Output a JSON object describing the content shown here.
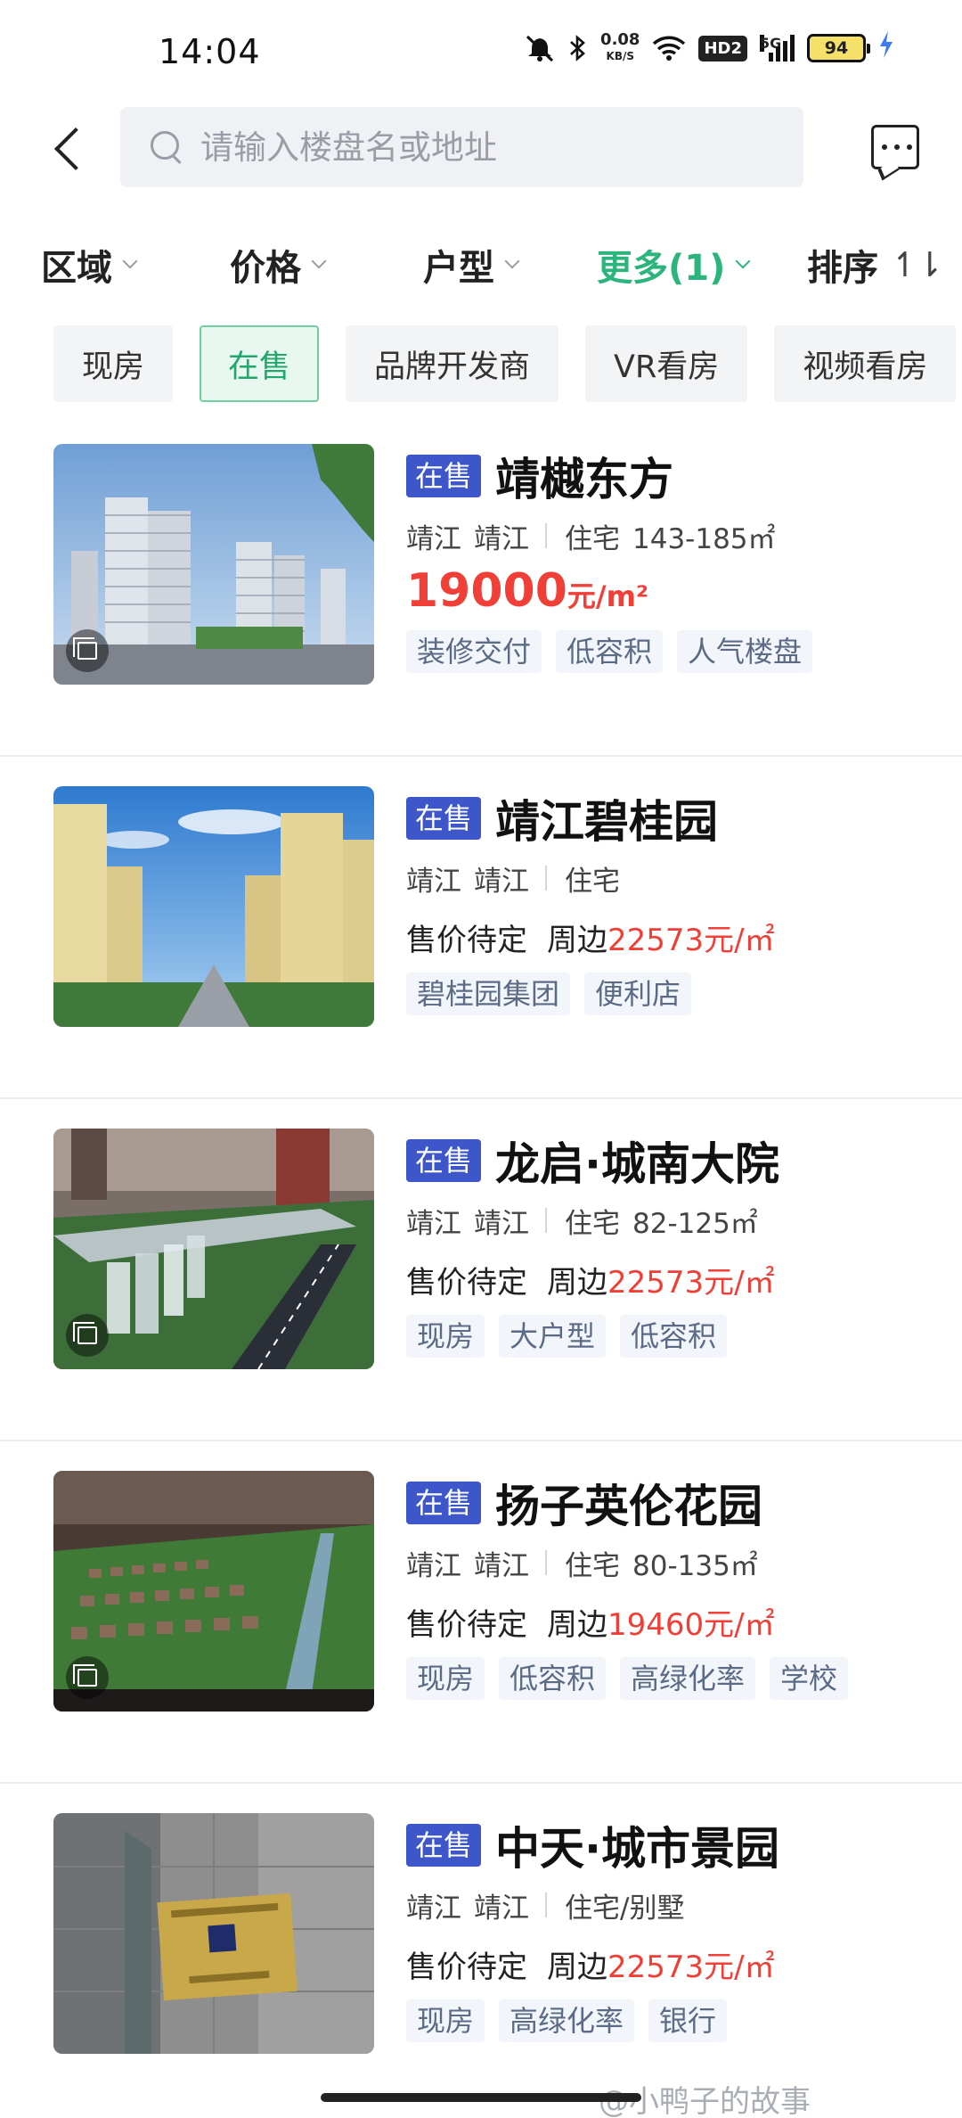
{
  "status_bar": {
    "time": "14:04",
    "net_speed_value": "0.08",
    "net_speed_unit": "KB/S",
    "hd_label": "HD2",
    "signal_label": "5G",
    "battery": "94",
    "icons": [
      "mute-icon",
      "bluetooth-icon",
      "wifi-icon",
      "charging-icon"
    ]
  },
  "header": {
    "search_placeholder": "请输入楼盘名或地址"
  },
  "filters": [
    {
      "label": "区域",
      "active": false
    },
    {
      "label": "价格",
      "active": false
    },
    {
      "label": "户型",
      "active": false
    },
    {
      "label": "更多(1)",
      "active": true
    },
    {
      "label": "排序",
      "active": false
    }
  ],
  "chips": [
    {
      "label": "现房",
      "selected": false
    },
    {
      "label": "在售",
      "selected": true
    },
    {
      "label": "品牌开发商",
      "selected": false
    },
    {
      "label": "VR看房",
      "selected": false
    },
    {
      "label": "视频看房",
      "selected": false
    }
  ],
  "listings": [
    {
      "status": "在售",
      "name": "靖樾东方",
      "district": "靖江",
      "area": "靖江",
      "type": "住宅",
      "size": "143-185㎡",
      "price_value": "19000",
      "price_unit": "元/m²",
      "tags": [
        "装修交付",
        "低容积",
        "人气楼盘"
      ],
      "has_vr": true
    },
    {
      "status": "在售",
      "name": "靖江碧桂园",
      "district": "靖江",
      "area": "靖江",
      "type": "住宅",
      "size": "",
      "price_pending": "售价待定",
      "nearby_label": "周边",
      "nearby_price": "22573元/㎡",
      "tags": [
        "碧桂园集团",
        "便利店"
      ],
      "has_vr": false
    },
    {
      "status": "在售",
      "name": "龙启·城南大院",
      "district": "靖江",
      "area": "靖江",
      "type": "住宅",
      "size": "82-125㎡",
      "price_pending": "售价待定",
      "nearby_label": "周边",
      "nearby_price": "22573元/㎡",
      "tags": [
        "现房",
        "大户型",
        "低容积"
      ],
      "has_vr": true
    },
    {
      "status": "在售",
      "name": "扬子英伦花园",
      "district": "靖江",
      "area": "靖江",
      "type": "住宅",
      "size": "80-135㎡",
      "price_pending": "售价待定",
      "nearby_label": "周边",
      "nearby_price": "19460元/㎡",
      "tags": [
        "现房",
        "低容积",
        "高绿化率",
        "学校"
      ],
      "has_vr": true
    },
    {
      "status": "在售",
      "name": "中天·城市景园",
      "district": "靖江",
      "area": "靖江",
      "type": "住宅/别墅",
      "size": "",
      "price_pending": "售价待定",
      "nearby_label": "周边",
      "nearby_price": "22573元/㎡",
      "tags": [
        "现房",
        "高绿化率",
        "银行"
      ],
      "has_vr": false
    }
  ],
  "watermark": "@小鸭子的故事",
  "colors": {
    "accent_green": "#2bb47b",
    "sale_badge_blue": "#3d56c9",
    "price_red": "#ef3f37"
  }
}
